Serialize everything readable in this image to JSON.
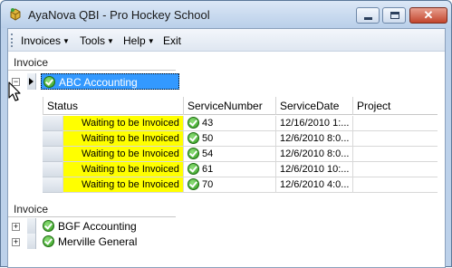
{
  "window": {
    "title": "AyaNova QBI - Pro Hockey School",
    "buttons": {
      "minimize": "minimize",
      "maximize": "maximize",
      "close": "✕"
    }
  },
  "menu": [
    {
      "label": "Invoices",
      "has_dropdown": true
    },
    {
      "label": "Tools",
      "has_dropdown": true
    },
    {
      "label": "Help",
      "has_dropdown": true
    },
    {
      "label": "Exit",
      "has_dropdown": false
    }
  ],
  "band1": {
    "header": "Invoice",
    "selected_client": "ABC Accounting",
    "expander": "−",
    "grid": {
      "columns": [
        "Status",
        "ServiceNumber",
        "ServiceDate",
        "Project"
      ],
      "rows": [
        {
          "status": "Waiting to be Invoiced",
          "service_number": "43",
          "service_date": "12/16/2010  1:...",
          "project": ""
        },
        {
          "status": "Waiting to be Invoiced",
          "service_number": "50",
          "service_date": "12/6/2010  8:0...",
          "project": ""
        },
        {
          "status": "Waiting to be Invoiced",
          "service_number": "54",
          "service_date": "12/6/2010  8:0...",
          "project": ""
        },
        {
          "status": "Waiting to be Invoiced",
          "service_number": "61",
          "service_date": "12/6/2010  10:...",
          "project": ""
        },
        {
          "status": "Waiting to be Invoiced",
          "service_number": "70",
          "service_date": "12/6/2010  4:0...",
          "project": ""
        }
      ]
    }
  },
  "band2": {
    "header": "Invoice",
    "clients": [
      {
        "name": "BGF Accounting",
        "expander": "+"
      },
      {
        "name": "Merville General",
        "expander": "+"
      }
    ]
  },
  "colors": {
    "selection": "#3399ff",
    "status_highlight": "#ffff00",
    "titlebar": "#c6d8ee"
  }
}
